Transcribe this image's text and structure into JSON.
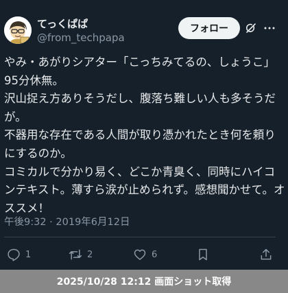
{
  "author": {
    "display_name": "てっくぱぱ",
    "handle": "@from_techpapa",
    "avatar_icon": "cartoon-face-avatar"
  },
  "header": {
    "follow_label": "フォロー",
    "grok_icon": "grok-icon",
    "more_icon": "more-icon"
  },
  "tweet": {
    "text": "やみ・あがりシアター「こっちみてるの、しょうこ」95分休無。\n沢山捉え方ありそうだし、腹落ち難しい人も多そうだが。\n不器用な存在である人間が取り憑かれたとき何を頼りにするのか。\nコミカルで分かり易く、どこか青臭く、同時にハイコンテキスト。薄すら涙が止められず。感想聞かせて。オススメ！",
    "timestamp": "午後9:32 · 2019年6月12日"
  },
  "actions": {
    "reply_count": "1",
    "retweet_count": "2",
    "like_count": "6",
    "icons": [
      "reply-icon",
      "retweet-icon",
      "like-icon",
      "bookmark-icon",
      "share-icon"
    ]
  },
  "screenshot_caption": "2025/10/28 12:12 画面ショット取得",
  "colors": {
    "background": "#15202b",
    "primary_text": "#e7e9ea",
    "secondary_text": "#8b98a5",
    "follow_button_bg": "#eff3f4",
    "caption_bar_bg": "#888888"
  }
}
